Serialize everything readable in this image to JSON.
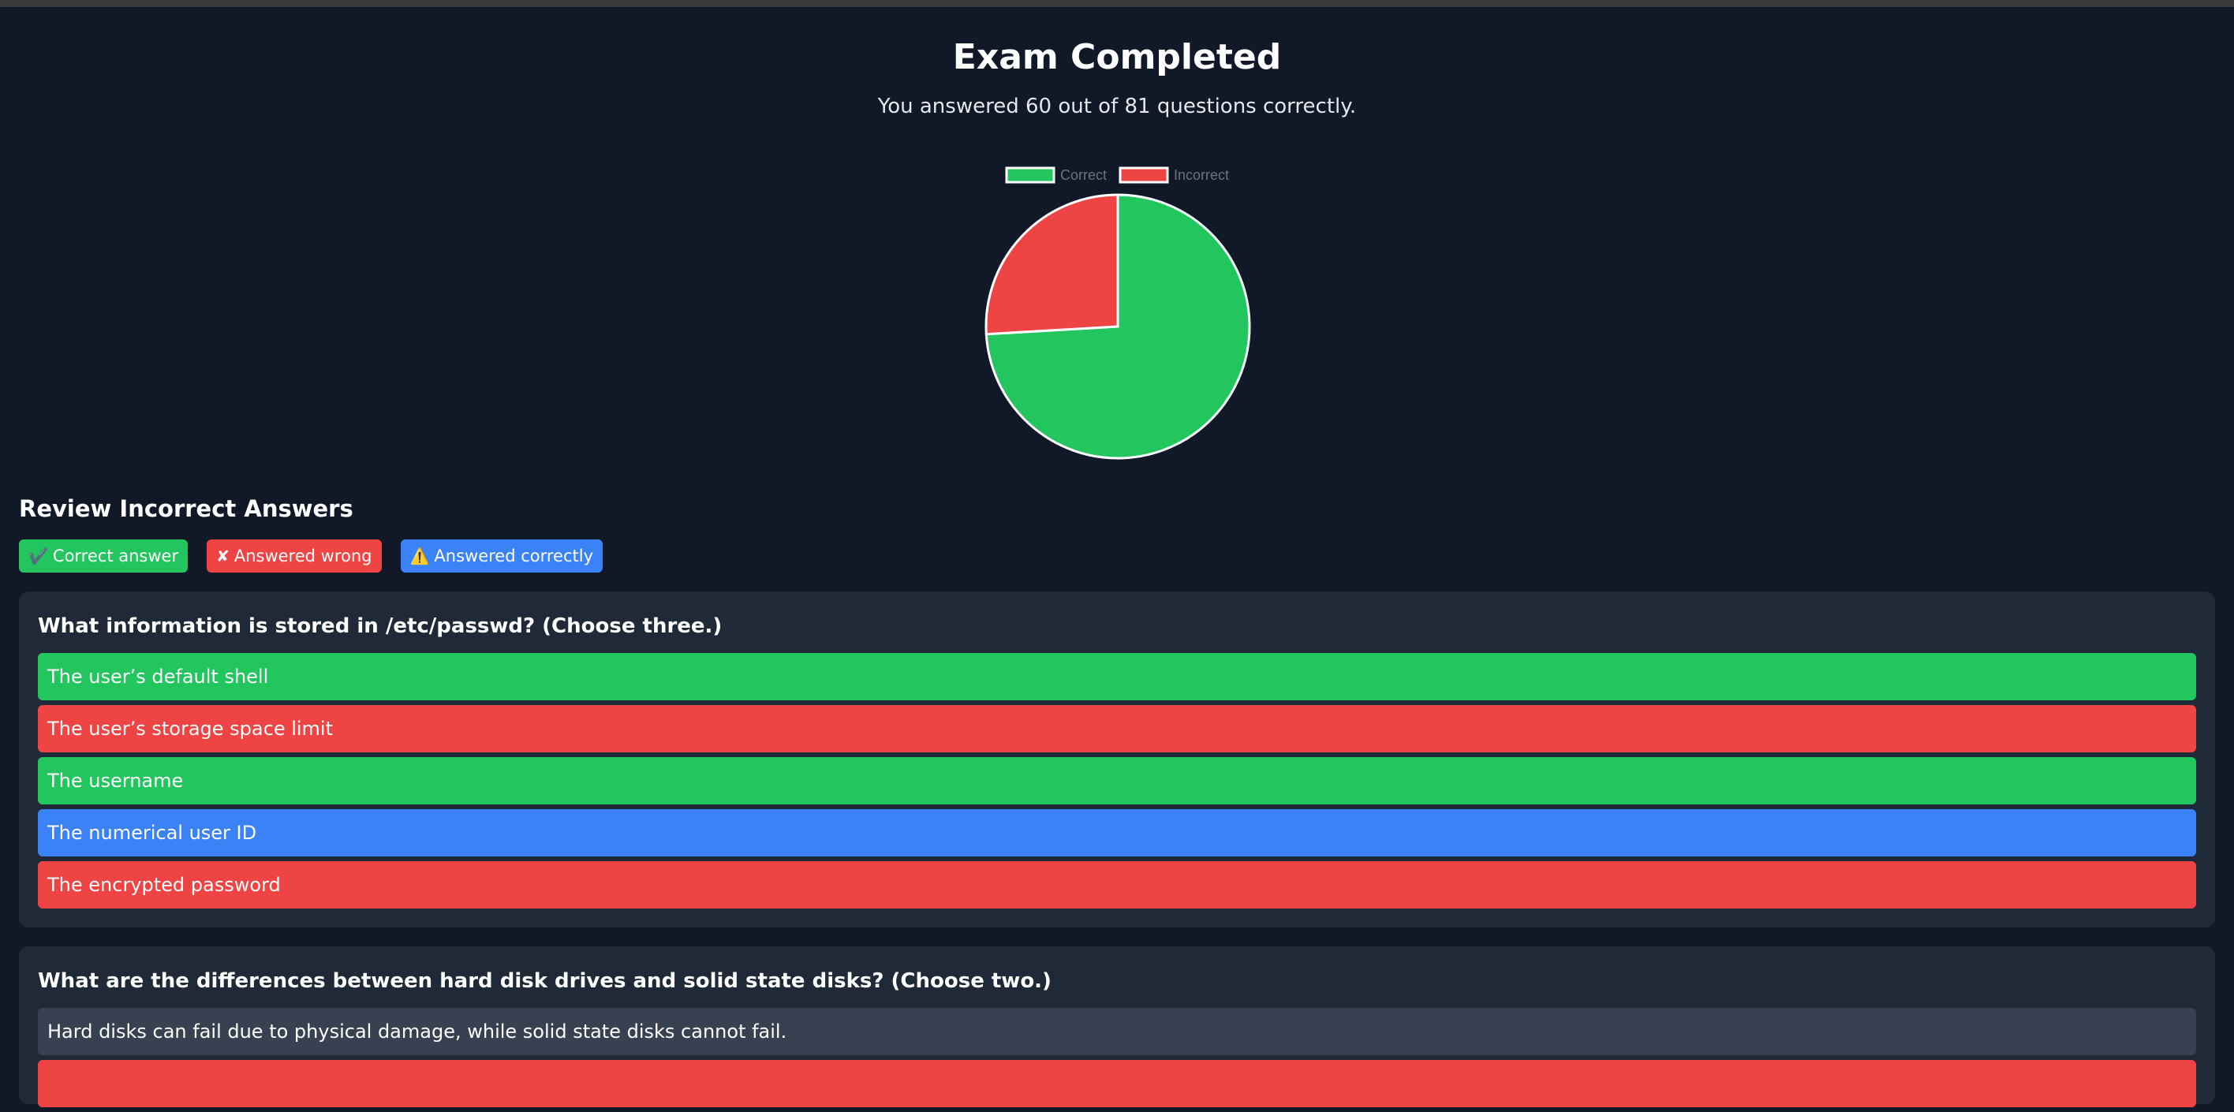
{
  "header": {
    "title": "Exam Completed",
    "summary": "You answered 60 out of 81 questions correctly."
  },
  "chart_data": {
    "type": "pie",
    "categories": [
      "Correct",
      "Incorrect"
    ],
    "values": [
      60,
      21
    ],
    "colors": [
      "#22c55e",
      "#ef4444"
    ],
    "legend_position": "top"
  },
  "review": {
    "title": "Review Incorrect Answers",
    "key": [
      {
        "glyph": "✔️",
        "label": "Correct answer",
        "color": "#22c55e"
      },
      {
        "glyph": "✘",
        "label": "Answered wrong",
        "color": "#ef4444"
      },
      {
        "glyph": "⚠️",
        "label": "Answered correctly",
        "color": "#3b82f6"
      }
    ]
  },
  "questions": [
    {
      "text": "What information is stored in /etc/passwd? (Choose three.)",
      "options": [
        {
          "text": "The user’s default shell",
          "status": "correct-answer"
        },
        {
          "text": "The user’s storage space limit",
          "status": "answered-wrong"
        },
        {
          "text": "The username",
          "status": "correct-answer"
        },
        {
          "text": "The numerical user ID",
          "status": "answered-correctly"
        },
        {
          "text": "The encrypted password",
          "status": "answered-wrong"
        }
      ]
    },
    {
      "text": "What are the differences between hard disk drives and solid state disks? (Choose two.)",
      "options": [
        {
          "text": "Hard disks can fail due to physical damage, while solid state disks cannot fail.",
          "status": "neutral"
        },
        {
          "text": "",
          "status": "answered-wrong"
        }
      ]
    }
  ]
}
